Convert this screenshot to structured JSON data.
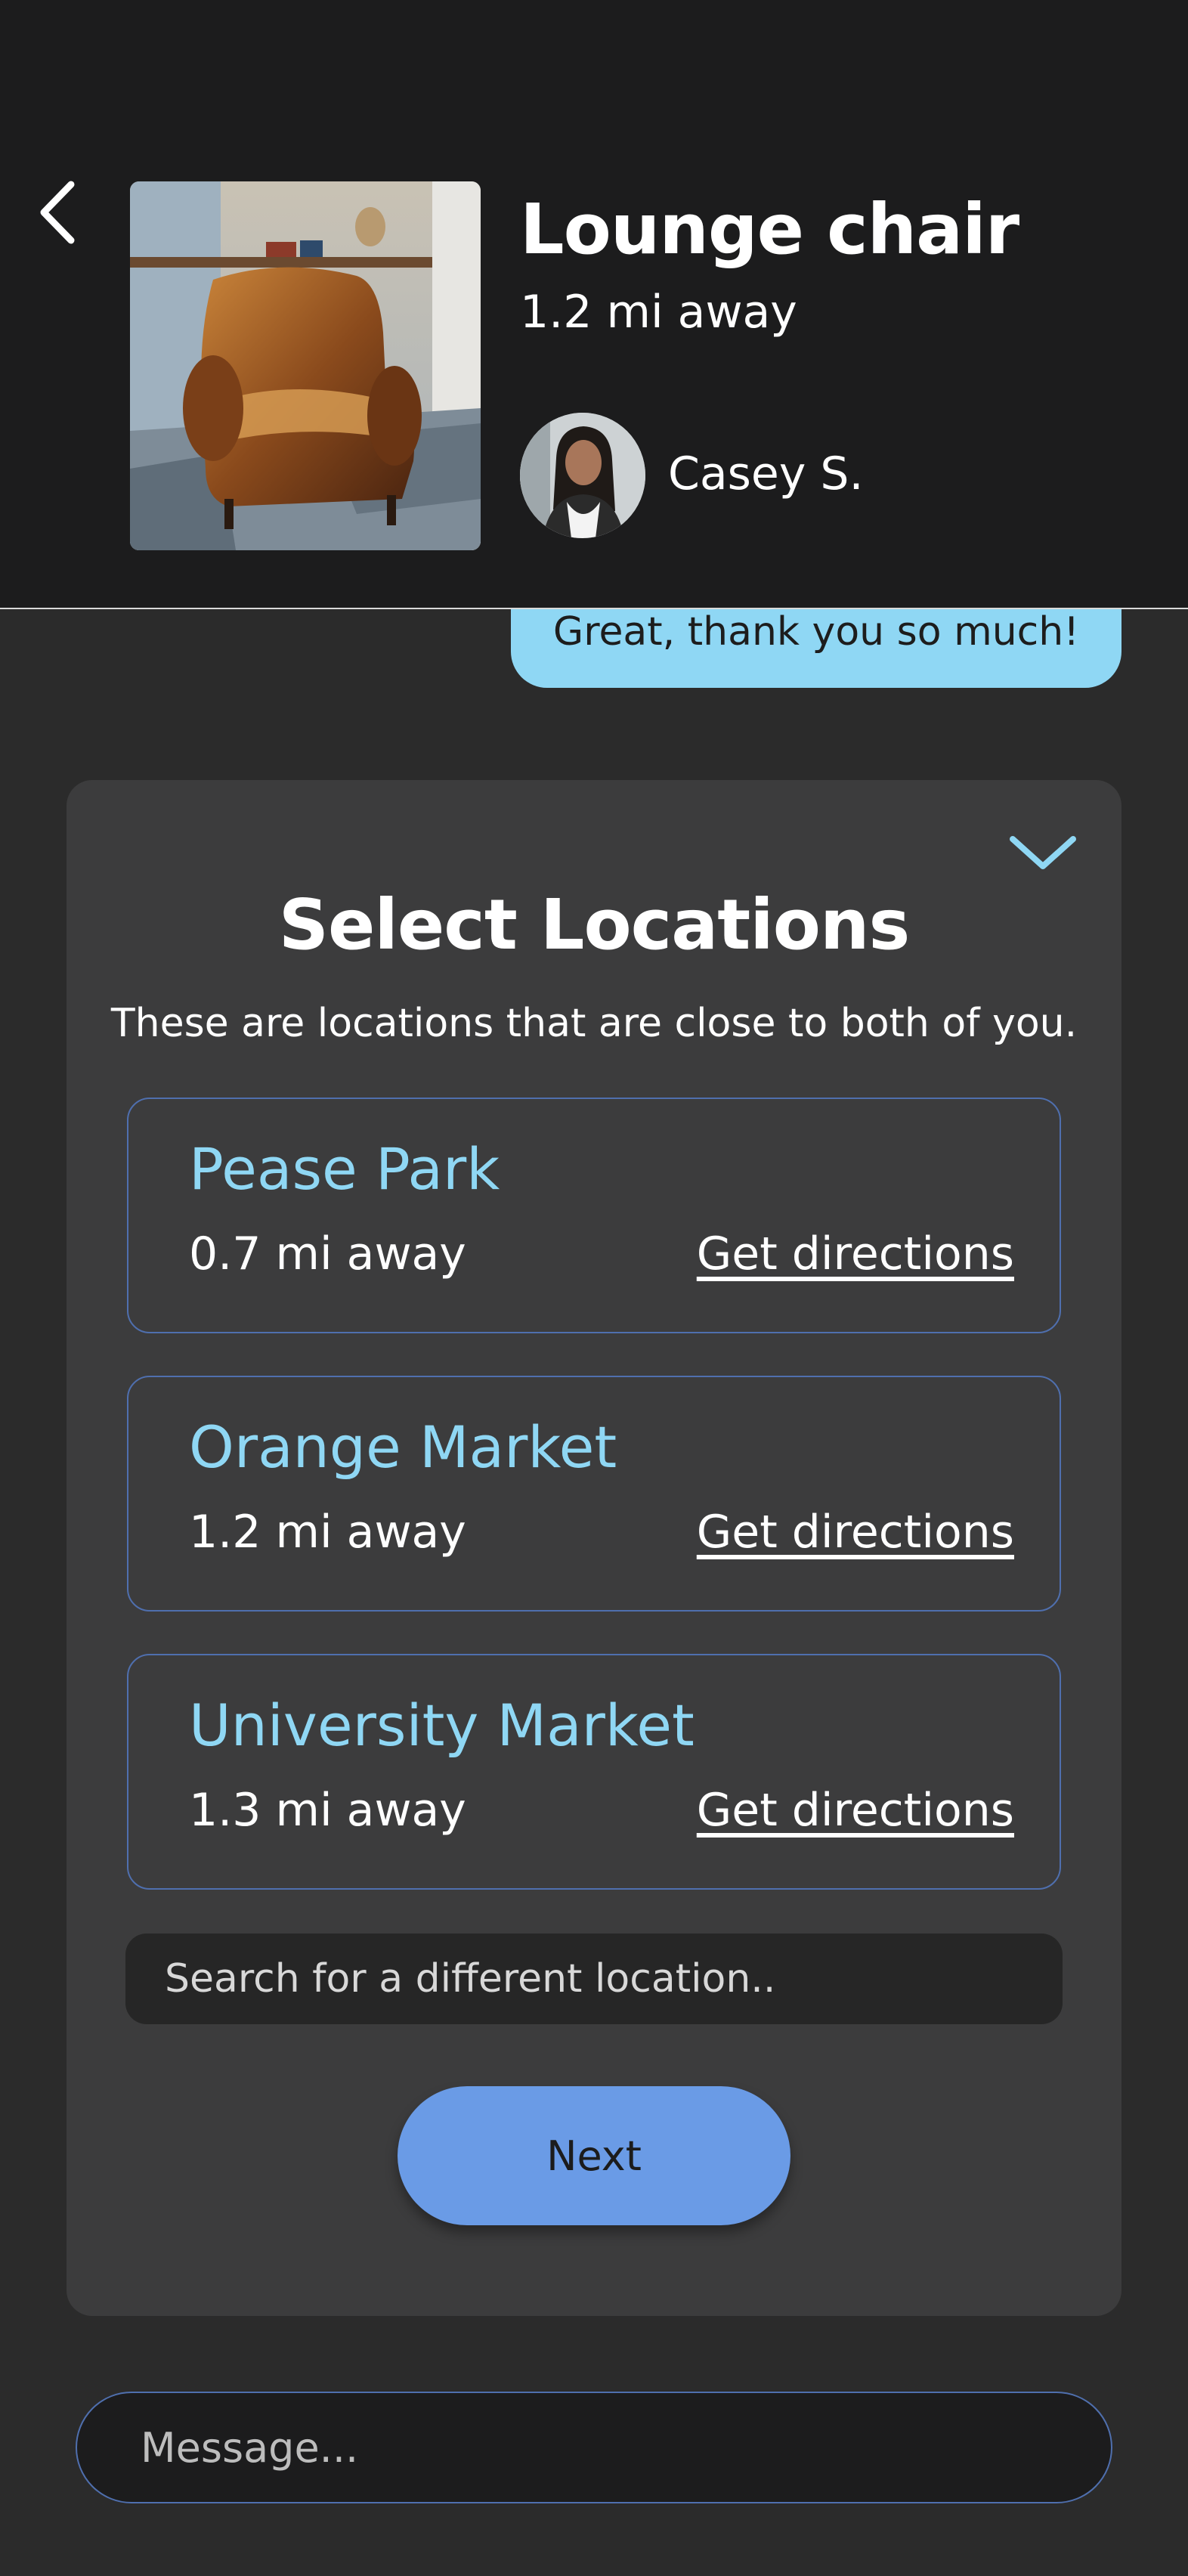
{
  "header": {
    "back_icon": "chevron-left-icon",
    "product_title": "Lounge chair",
    "product_distance": "1.2 mi away",
    "seller_name": "Casey S."
  },
  "chat": {
    "last_message": "Great, thank you so much!"
  },
  "location_card": {
    "collapse_icon": "chevron-down-icon",
    "title": "Select Locations",
    "subtitle": "These are locations that are close to both of you.",
    "locations": [
      {
        "name": "Pease Park",
        "distance": "0.7 mi away",
        "directions_label": "Get directions"
      },
      {
        "name": "Orange Market",
        "distance": "1.2 mi away",
        "directions_label": "Get directions"
      },
      {
        "name": "University Market",
        "distance": "1.3 mi away",
        "directions_label": "Get directions"
      }
    ],
    "search_placeholder": "Search for a different location..",
    "next_label": "Next"
  },
  "composer": {
    "placeholder": "Message..."
  },
  "colors": {
    "background": "#2b2b2b",
    "header": "#1c1c1d",
    "card": "#3c3c3d",
    "accent_cyan": "#8fd7f4",
    "primary_button": "#6a9be6",
    "border_blue": "#4f6fae"
  }
}
